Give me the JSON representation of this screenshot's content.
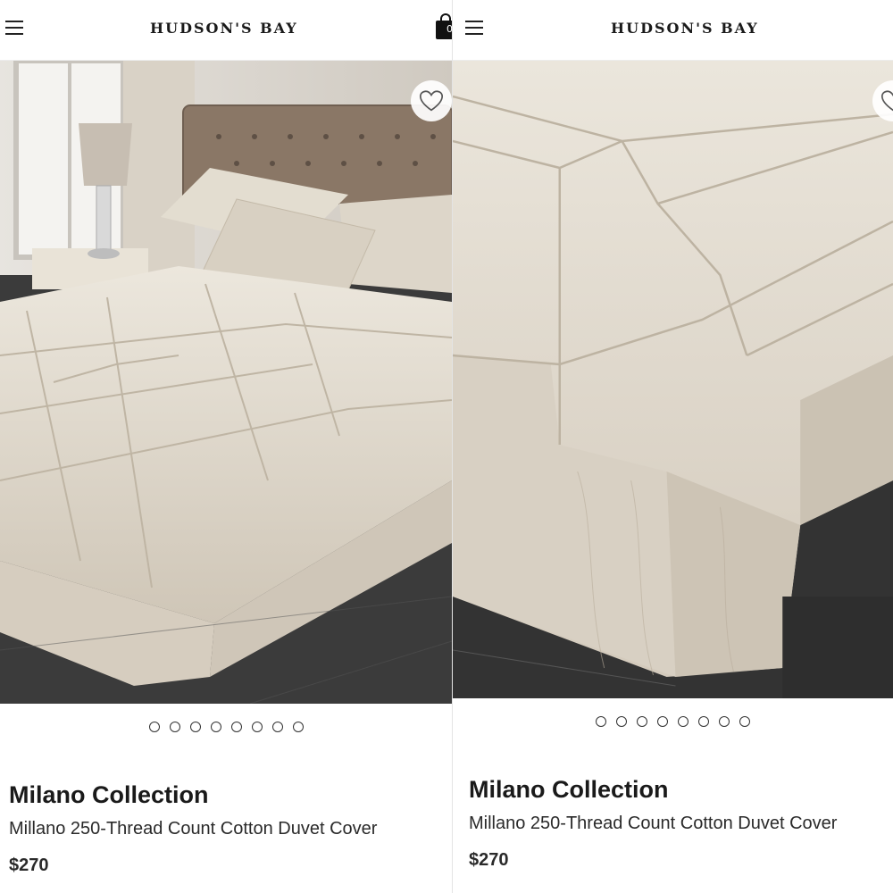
{
  "left": {
    "store_name": "HUDSON'S BAY",
    "cart_count": "0",
    "carousel_dot_count": 8,
    "product": {
      "brand": "Milano Collection",
      "name": "Millano 250-Thread Count Cotton Duvet Cover",
      "price": "$270"
    }
  },
  "right": {
    "store_name": "HUDSON'S BAY",
    "carousel_dot_count": 8,
    "product": {
      "brand": "Milano Collection",
      "name": "Millano 250-Thread Count Cotton Duvet Cover",
      "price": "$270"
    }
  },
  "icons": {
    "menu": "hamburger-menu-icon",
    "bag": "shopping-bag-icon",
    "wishlist": "heart-outline-icon"
  },
  "colors": {
    "duvet": "#ddd6c9",
    "headboard": "#8a7766",
    "floor": "#3a3a3a",
    "text": "#222222"
  }
}
